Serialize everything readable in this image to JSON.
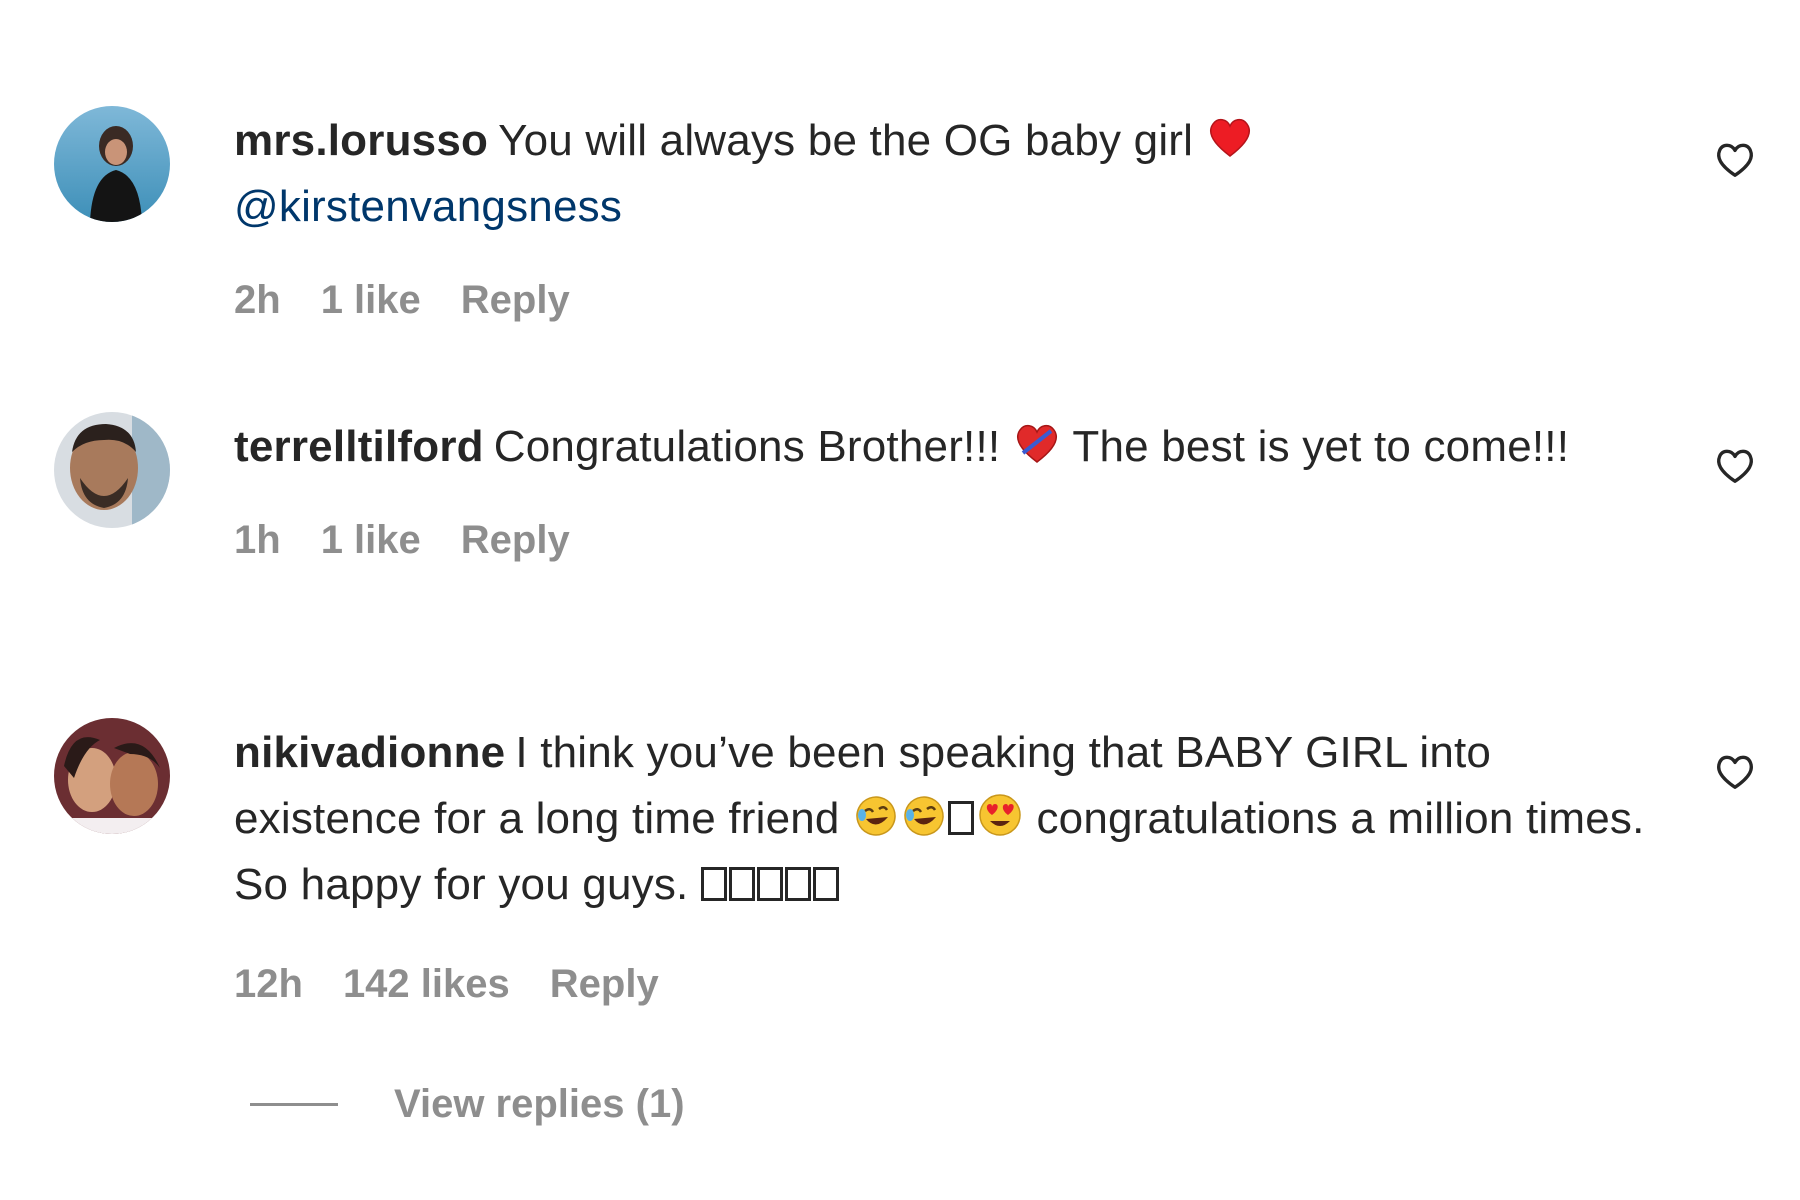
{
  "comments": [
    {
      "username": "mrs.lorusso",
      "text_before": "You will always be the OG baby girl",
      "emoji1": "red-heart-emoji",
      "mention": "@kirstenvangsness",
      "time": "2h",
      "likes": "1 like",
      "reply": "Reply"
    },
    {
      "username": "terrelltilford",
      "text_before": "Congratulations Brother!!!",
      "emoji1": "broken-heart-emoji",
      "text_after": "The best is yet to come!!!",
      "time": "1h",
      "likes": "1 like",
      "reply": "Reply"
    },
    {
      "username": "nikivadionne",
      "text_before": "I think you’ve been speaking that BABY GIRL into existence for a long time friend",
      "emojis": [
        "laughing-emoji",
        "laughing-emoji",
        "missing-glyph",
        "heart-eyes-emoji"
      ],
      "text_middle": "congratulations a million times. So happy for you guys.",
      "trailing_glyphs": [
        "missing-glyph",
        "missing-glyph",
        "missing-glyph",
        "missing-glyph",
        "missing-glyph"
      ],
      "time": "12h",
      "likes": "142 likes",
      "reply": "Reply"
    }
  ],
  "view_replies": "View replies (1)",
  "colors": {
    "text": "#262626",
    "secondary": "#8e8e8e",
    "mention": "#00376b",
    "heart": "#ed1c24"
  }
}
